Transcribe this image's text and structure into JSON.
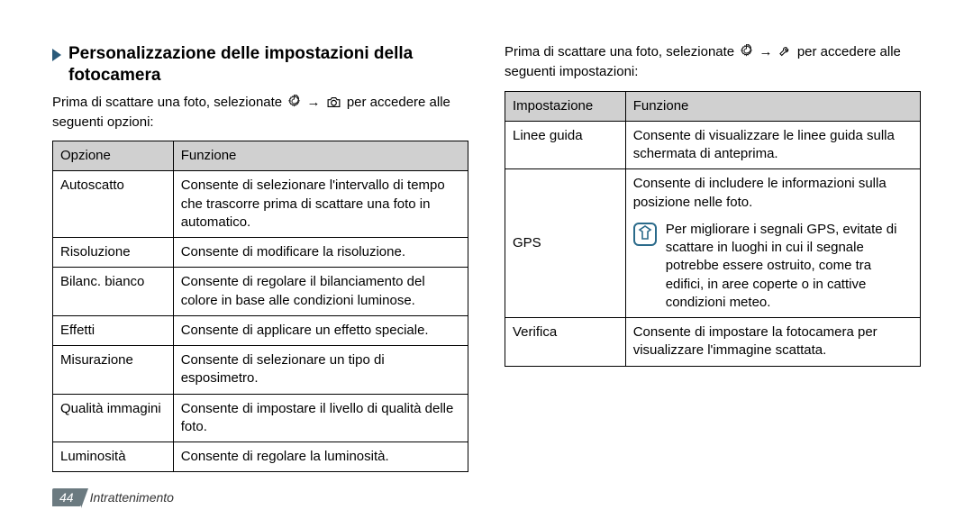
{
  "heading": "Personalizzazione delle impostazioni della fotocamera",
  "intro_left_pre": "Prima di scattare una foto, selezionate ",
  "intro_left_mid": " → ",
  "intro_left_post": " per accedere alle seguenti opzioni:",
  "intro_right_pre": "Prima di scattare una foto, selezionate ",
  "intro_right_mid": " → ",
  "intro_right_post": " per accedere alle seguenti impostazioni:",
  "table_left": {
    "head": {
      "c1": "Opzione",
      "c2": "Funzione"
    },
    "rows": [
      {
        "c1": "Autoscatto",
        "c2": "Consente di selezionare l'intervallo di tempo che trascorre prima di scattare una foto in automatico."
      },
      {
        "c1": "Risoluzione",
        "c2": "Consente di modificare la risoluzione."
      },
      {
        "c1": "Bilanc. bianco",
        "c2": "Consente di regolare il bilanciamento del colore in base alle condizioni luminose."
      },
      {
        "c1": "Effetti",
        "c2": "Consente di applicare un effetto speciale."
      },
      {
        "c1": "Misurazione",
        "c2": "Consente di selezionare un tipo di esposimetro."
      },
      {
        "c1": "Qualità immagini",
        "c2": "Consente di impostare il livello di qualità delle foto."
      },
      {
        "c1": "Luminosità",
        "c2": "Consente di regolare la luminosità."
      }
    ]
  },
  "table_right": {
    "head": {
      "c1": "Impostazione",
      "c2": "Funzione"
    },
    "rows": [
      {
        "c1": "Linee guida",
        "c2": "Consente di visualizzare le linee guida sulla schermata di anteprima."
      },
      {
        "c1": "GPS",
        "c2_top": "Consente di includere le informazioni sulla posizione nelle foto.",
        "c2_note": "Per migliorare i segnali GPS, evitate di scattare in luoghi in cui il segnale potrebbe essere ostruito, come tra edifici, in aree coperte o in cattive condizioni meteo."
      },
      {
        "c1": "Verifica",
        "c2": "Consente di impostare la fotocamera per visualizzare l'immagine scattata."
      }
    ]
  },
  "footer": {
    "page": "44",
    "chapter": "Intrattenimento"
  }
}
